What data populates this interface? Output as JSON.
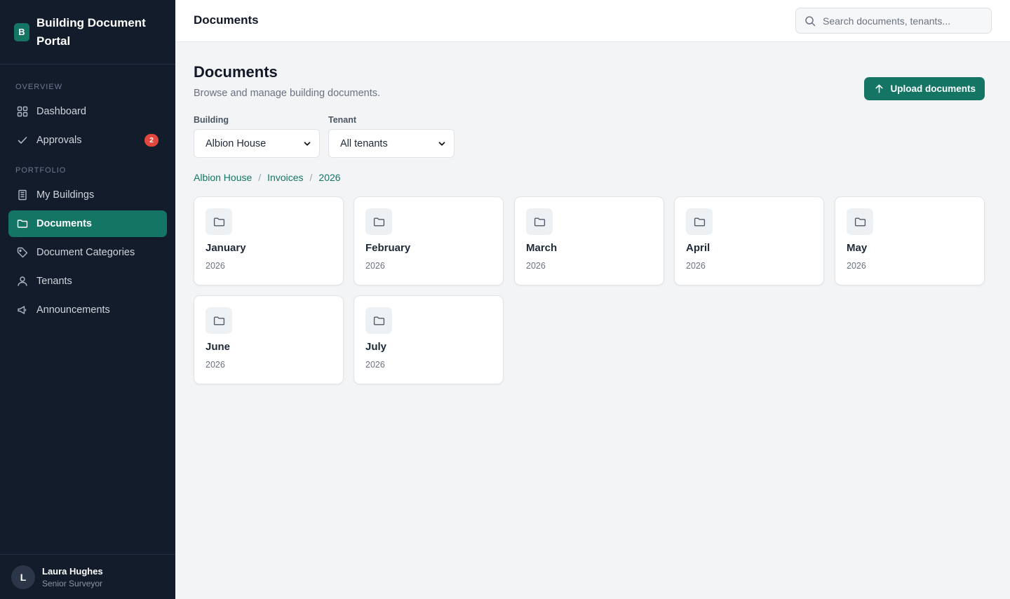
{
  "app": {
    "name": "Building Document Portal",
    "logo_letter": "B"
  },
  "sidebar": {
    "sections": [
      {
        "label": "OVERVIEW"
      },
      {
        "label": "PORTFOLIO"
      }
    ],
    "items": [
      {
        "label": "Dashboard",
        "icon": "grid-icon"
      },
      {
        "label": "Approvals",
        "icon": "check-icon",
        "badge": "2"
      },
      {
        "label": "My Buildings",
        "icon": "building-icon"
      },
      {
        "label": "Documents",
        "icon": "folder-icon",
        "active": true
      },
      {
        "label": "Document Categories",
        "icon": "tag-icon"
      },
      {
        "label": "Tenants",
        "icon": "user-icon"
      },
      {
        "label": "Announcements",
        "icon": "megaphone-icon"
      }
    ]
  },
  "user": {
    "initial": "L",
    "name": "Laura Hughes",
    "role": "Senior Surveyor"
  },
  "header": {
    "title": "Documents",
    "search_placeholder": "Search documents, tenants..."
  },
  "page": {
    "title": "Documents",
    "subtitle": "Browse and manage building documents.",
    "upload_label": "Upload documents"
  },
  "filters": {
    "building": {
      "label": "Building",
      "value": "Albion House"
    },
    "tenant": {
      "label": "Tenant",
      "value": "All tenants"
    }
  },
  "breadcrumb": [
    "Albion House",
    "Invoices",
    "2026"
  ],
  "folders": [
    {
      "name": "January",
      "year": "2026"
    },
    {
      "name": "February",
      "year": "2026"
    },
    {
      "name": "March",
      "year": "2026"
    },
    {
      "name": "April",
      "year": "2026"
    },
    {
      "name": "May",
      "year": "2026"
    },
    {
      "name": "June",
      "year": "2026"
    },
    {
      "name": "July",
      "year": "2026"
    }
  ],
  "colors": {
    "accent": "#147565",
    "sidebar_bg": "#131c2b",
    "badge": "#e3483e"
  }
}
